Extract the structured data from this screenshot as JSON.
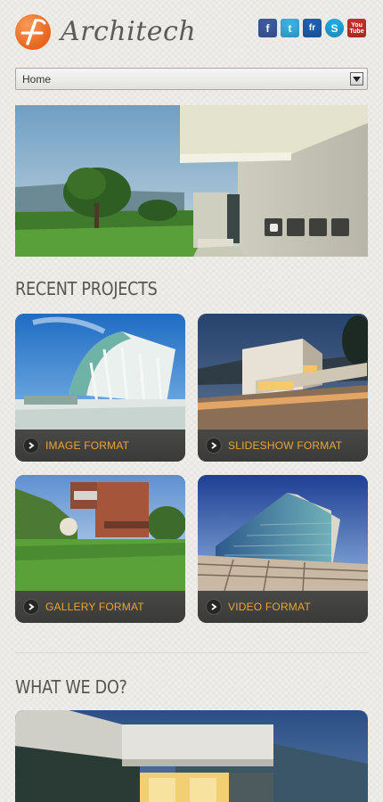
{
  "header": {
    "logo_text": "Architech",
    "social": [
      {
        "icon": "facebook-icon",
        "glyph": "f",
        "color": "#3b5b9f"
      },
      {
        "icon": "twitter-icon",
        "glyph": "t",
        "color": "#39aee1"
      },
      {
        "icon": "friendster-icon",
        "glyph": "fr",
        "color": "#1f5faf"
      },
      {
        "icon": "skype-icon",
        "glyph": "S",
        "color": "#1fa7e2"
      },
      {
        "icon": "youtube-icon",
        "glyph": "You Tube",
        "color": "#c4302b"
      }
    ]
  },
  "nav": {
    "selected": "Home"
  },
  "hero": {
    "slides": 4,
    "active_slide": 1
  },
  "recent_projects": {
    "title": "RECENT PROJECTS",
    "cards": [
      {
        "label": "IMAGE FORMAT"
      },
      {
        "label": "SLIDESHOW FORMAT"
      },
      {
        "label": "GALLERY FORMAT"
      },
      {
        "label": "VIDEO FORMAT"
      }
    ]
  },
  "what_we_do": {
    "title": "WHAT WE DO?"
  },
  "colors": {
    "accent": "#e7a637",
    "logo": "#e8641c",
    "card_bar": "#3f403d"
  }
}
